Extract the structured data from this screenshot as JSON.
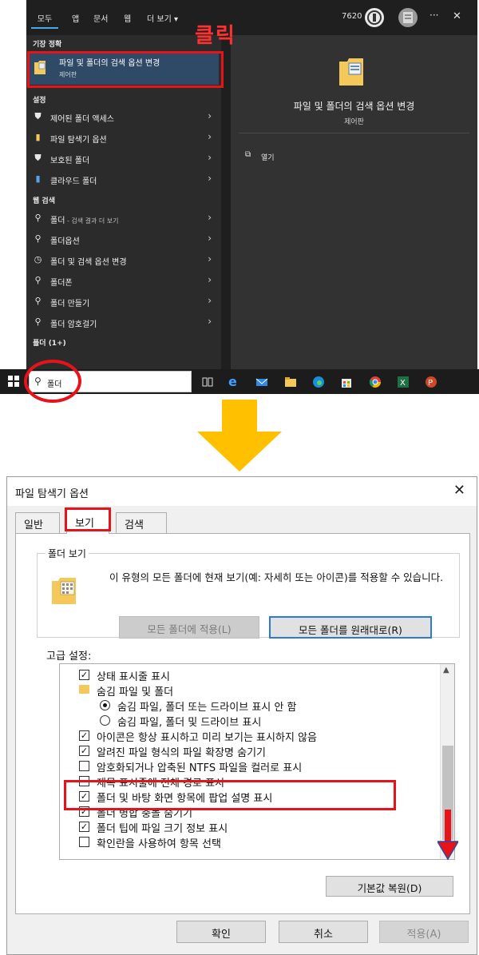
{
  "start_menu": {
    "filter_tabs": [
      "모두",
      "앱",
      "문서",
      "웹",
      "더 보기 ▾"
    ],
    "points": "7620",
    "more_label": "···",
    "close_label": "✕",
    "best_match_heading": "기장 정확",
    "best_match": {
      "title": "파일 및 폴더의 검색 옵션 변경",
      "subtitle": "제어판"
    },
    "settings_heading": "설정",
    "settings_items": [
      "제어된 폴더 액세스",
      "파일 탐색기 옵션",
      "보호된 폴더",
      "클라우드 폴더"
    ],
    "web_heading": "웹 검색",
    "web_items": [
      {
        "label": "폴더",
        "sub": " - 검색 결과 더 보기"
      },
      {
        "label": "폴더옵션",
        "sub": ""
      },
      {
        "label": "폴더 및 검색 옵션 변경",
        "sub": ""
      },
      {
        "label": "폴더폰",
        "sub": ""
      },
      {
        "label": "폴더 만들기",
        "sub": ""
      },
      {
        "label": "폴더 암호걸기",
        "sub": ""
      }
    ],
    "folders_heading": "폴더 (1+)",
    "preview": {
      "title": "파일 및 폴더의 검색 옵션 변경",
      "subtitle": "제어판",
      "open_label": "열기"
    },
    "annotation_click": "클릭"
  },
  "taskbar": {
    "search_text": "폴더"
  },
  "dialog": {
    "title": "파일 탐색기 옵션",
    "close_label": "✕",
    "tabs": [
      "일반",
      "보기",
      "검색"
    ],
    "folder_view_label": "폴더 보기",
    "folder_view_desc": "이 유형의 모든 폴더에 현재 보기(예: 자세히 또는 아이콘)를 적용할 수 있습니다.",
    "apply_all_button": "모든 폴더에 적용(L)",
    "reset_all_button": "모든 폴더를 원래대로(R)",
    "advanced_label": "고급 설정:",
    "advanced_items": [
      {
        "kind": "check",
        "checked": true,
        "indent": 0,
        "label": "상태 표시줄 표시"
      },
      {
        "kind": "folder",
        "checked": false,
        "indent": 0,
        "label": "숨김 파일 및 폴더"
      },
      {
        "kind": "radio",
        "checked": true,
        "indent": 1,
        "label": "숨김 파일, 폴더 또는 드라이브 표시 안 함"
      },
      {
        "kind": "radio",
        "checked": false,
        "indent": 1,
        "label": "숨김 파일, 폴더 및 드라이브 표시"
      },
      {
        "kind": "check",
        "checked": true,
        "indent": 0,
        "label": "아이콘은 항상 표시하고 미리 보기는 표시하지 않음"
      },
      {
        "kind": "check",
        "checked": true,
        "indent": 0,
        "label": "알려진 파일 형식의 파일 확장명 숨기기"
      },
      {
        "kind": "check",
        "checked": false,
        "indent": 0,
        "label": "암호화되거나 압축된 NTFS 파일을 컬러로 표시"
      },
      {
        "kind": "check",
        "checked": false,
        "indent": 0,
        "label": "제목 표시줄에 전체 경로 표시"
      },
      {
        "kind": "check",
        "checked": true,
        "indent": 0,
        "label": "폴더 및 바탕 화면 항목에 팝업 설명 표시"
      },
      {
        "kind": "check",
        "checked": true,
        "indent": 0,
        "label": "폴더 병합 충돌 숨기기"
      },
      {
        "kind": "check",
        "checked": true,
        "indent": 0,
        "label": "폴더 팁에 파일 크기 정보 표시"
      },
      {
        "kind": "check",
        "checked": false,
        "indent": 0,
        "label": "확인란을 사용하여 항목 선택"
      }
    ],
    "restore_defaults_button": "기본값 복원(D)",
    "ok_button": "확인",
    "cancel_button": "취소",
    "apply_button": "적용(A)"
  },
  "colors": {
    "highlight_red": "#e6141a",
    "arrow_yellow": "#ffc000",
    "accent_blue": "#2a7ad6"
  }
}
